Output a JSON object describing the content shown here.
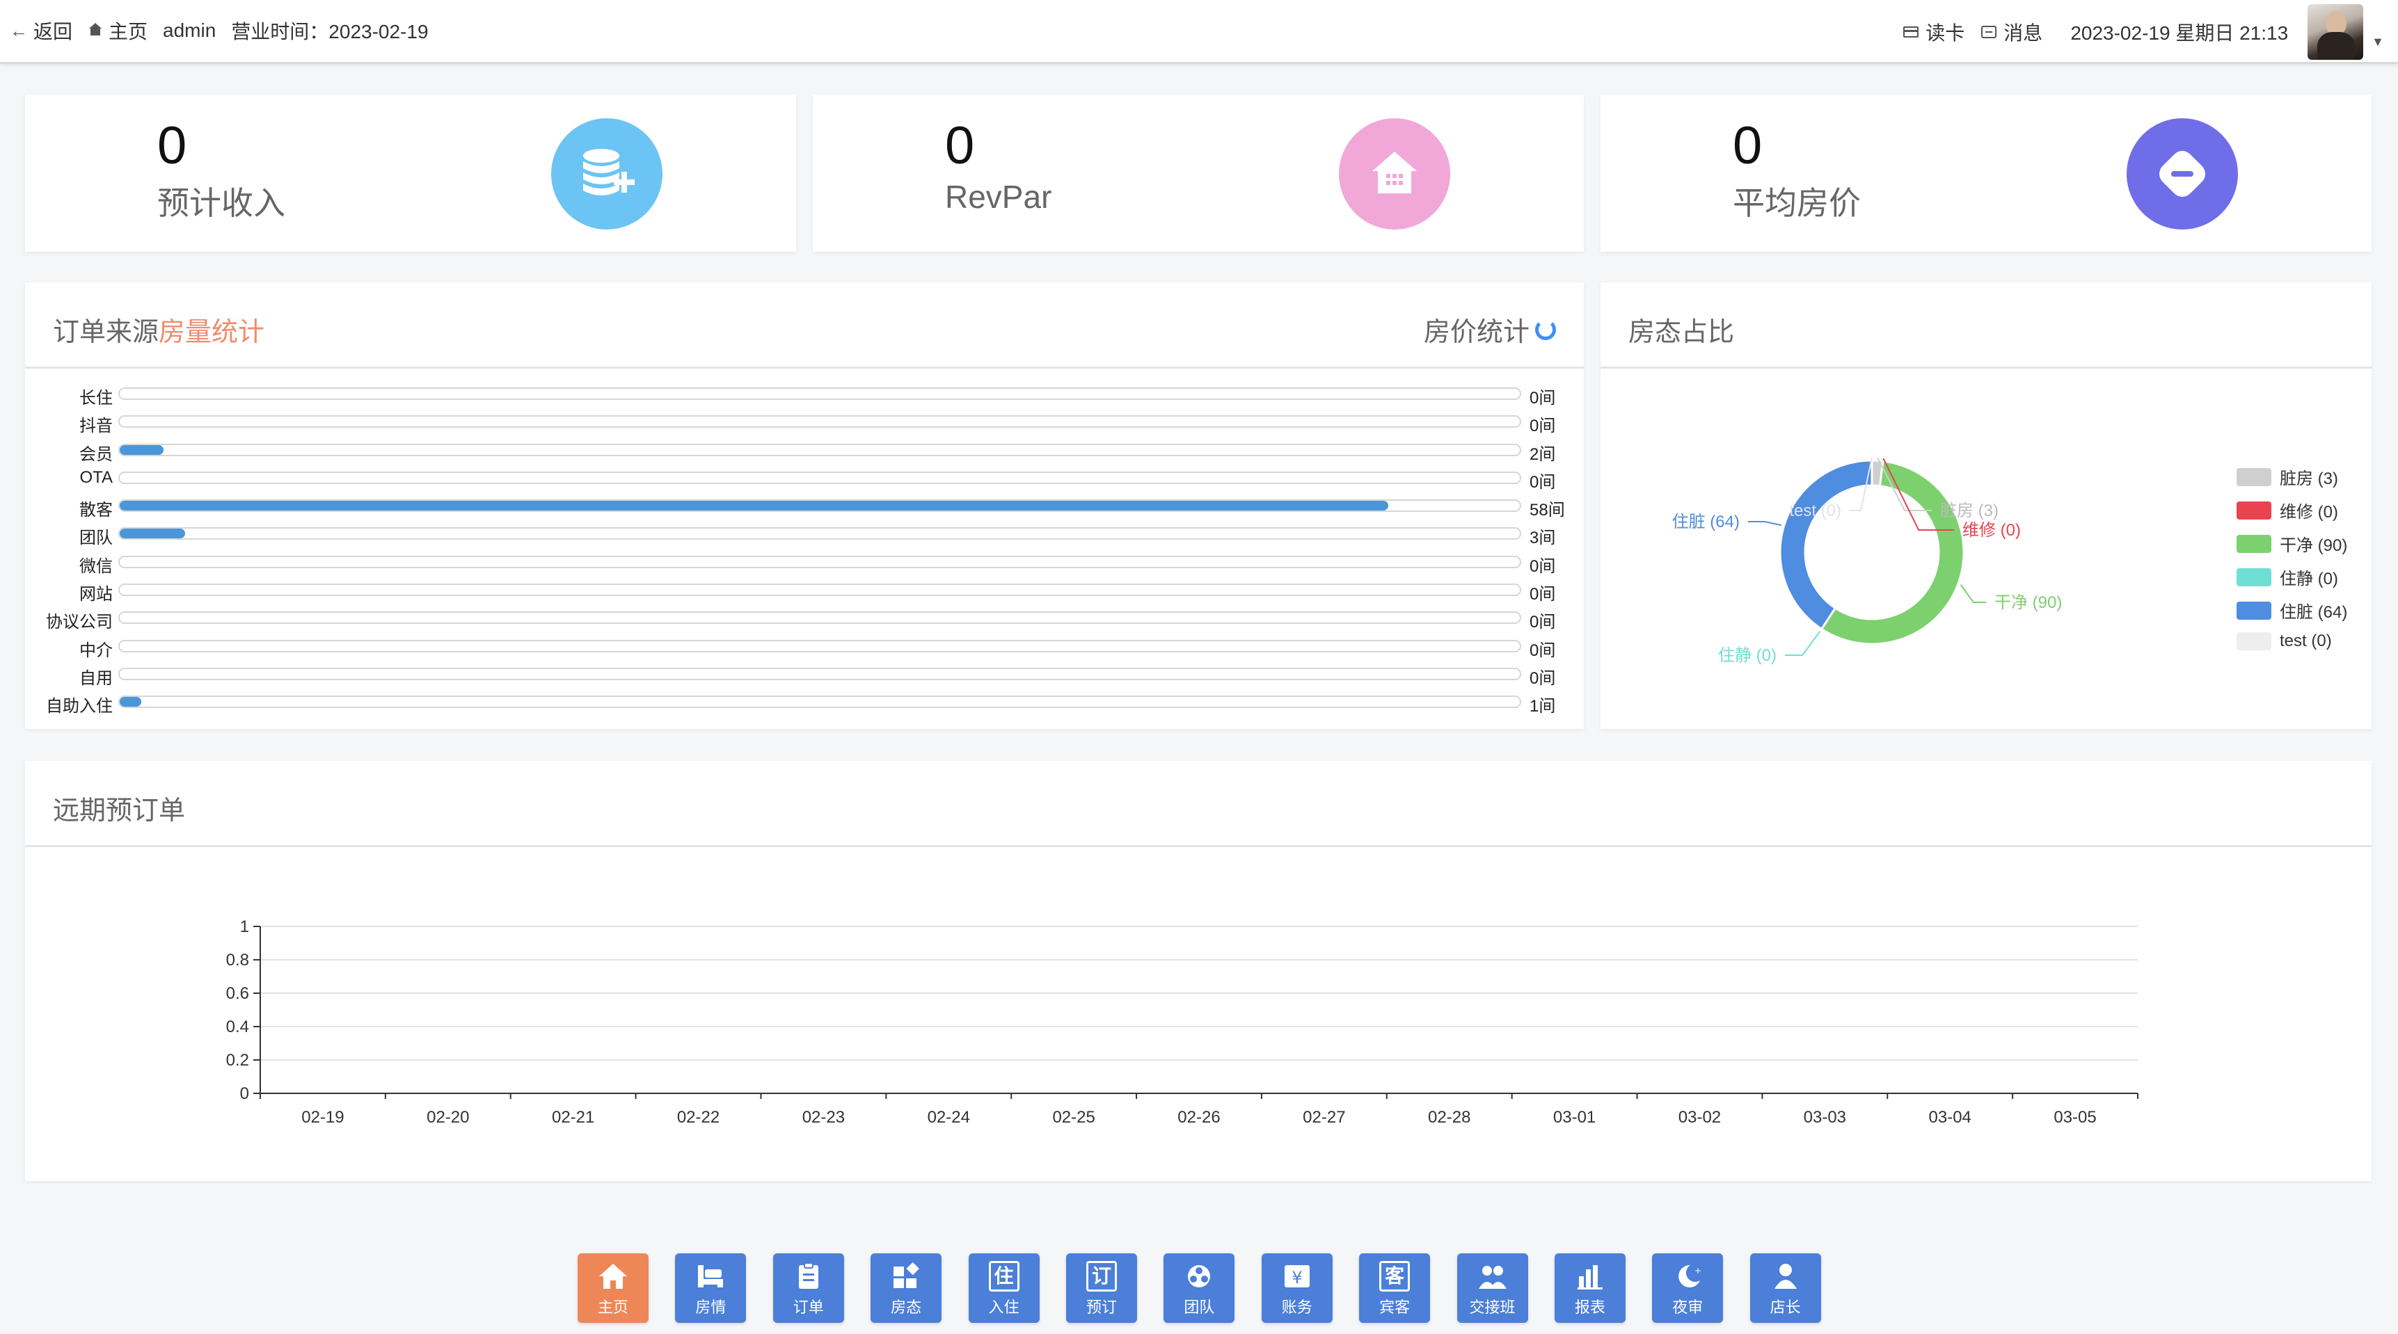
{
  "topbar": {
    "back": "返回",
    "home": "主页",
    "user": "admin",
    "business_time": "营业时间：2023-02-19",
    "read_card": "读卡",
    "message": "消息",
    "datetime": "2023-02-19 星期日 21:13"
  },
  "stats": [
    {
      "value": "0",
      "label": "预计收入",
      "icon": "coin-stack-plus-icon",
      "color": "#6cc4f4"
    },
    {
      "value": "0",
      "label": "RevPar",
      "icon": "house-icon",
      "color": "#f1a8d8"
    },
    {
      "value": "0",
      "label": "平均房价",
      "icon": "minus-circle-icon",
      "color": "#6f6ee8"
    }
  ],
  "order_panel": {
    "title_a": "订单来源",
    "title_b": "房量统计",
    "price_stat": "房价统计",
    "rows": [
      {
        "name": "长住",
        "value": 0,
        "label": "0间"
      },
      {
        "name": "抖音",
        "value": 0,
        "label": "0间"
      },
      {
        "name": "会员",
        "value": 2,
        "label": "2间"
      },
      {
        "name": "OTA",
        "value": 0,
        "label": "0间"
      },
      {
        "name": "散客",
        "value": 58,
        "label": "58间"
      },
      {
        "name": "团队",
        "value": 3,
        "label": "3间"
      },
      {
        "name": "微信",
        "value": 0,
        "label": "0间"
      },
      {
        "name": "网站",
        "value": 0,
        "label": "0间"
      },
      {
        "name": "协议公司",
        "value": 0,
        "label": "0间"
      },
      {
        "name": "中介",
        "value": 0,
        "label": "0间"
      },
      {
        "name": "自用",
        "value": 0,
        "label": "0间"
      },
      {
        "name": "自助入住",
        "value": 1,
        "label": "1间"
      }
    ],
    "max": 64
  },
  "room_panel": {
    "title": "房态占比",
    "slices": [
      {
        "name": "脏房",
        "value": 3,
        "label": "脏房 (3)",
        "color": "#cfcfcf"
      },
      {
        "name": "维修",
        "value": 0,
        "label": "维修 (0)",
        "color": "#e8434f"
      },
      {
        "name": "干净",
        "value": 90,
        "label": "干净 (90)",
        "color": "#7dd06e"
      },
      {
        "name": "住静",
        "value": 0,
        "label": "住静 (0)",
        "color": "#6fdfd3"
      },
      {
        "name": "住脏",
        "value": 64,
        "label": "住脏 (64)",
        "color": "#4e8de0"
      },
      {
        "name": "test",
        "value": 0,
        "label": "test (0)",
        "color": "#eeeeee"
      }
    ]
  },
  "future_panel": {
    "title": "远期预订单"
  },
  "chart_data": {
    "type": "line",
    "title": "",
    "categories": [
      "02-19",
      "02-20",
      "02-21",
      "02-22",
      "02-23",
      "02-24",
      "02-25",
      "02-26",
      "02-27",
      "02-28",
      "03-01",
      "03-02",
      "03-03",
      "03-04",
      "03-05"
    ],
    "series": [],
    "ylim": [
      0,
      1
    ],
    "yticks": [
      "0",
      "0.2",
      "0.4",
      "0.6",
      "0.8",
      "1"
    ],
    "grid": true
  },
  "dock": [
    {
      "label": "主页",
      "icon": "home-icon",
      "active": true
    },
    {
      "label": "房情",
      "icon": "bed-icon"
    },
    {
      "label": "订单",
      "icon": "clipboard-icon"
    },
    {
      "label": "房态",
      "icon": "grid-diamond-icon"
    },
    {
      "label": "入住",
      "icon": "checkin-icon",
      "glyph": "住"
    },
    {
      "label": "预订",
      "icon": "booking-icon",
      "glyph": "订"
    },
    {
      "label": "团队",
      "icon": "team-icon"
    },
    {
      "label": "账务",
      "icon": "ledger-icon"
    },
    {
      "label": "宾客",
      "icon": "guest-icon",
      "glyph": "客"
    },
    {
      "label": "交接班",
      "icon": "handover-icon"
    },
    {
      "label": "报表",
      "icon": "bar-chart-icon"
    },
    {
      "label": "夜审",
      "icon": "moon-icon"
    },
    {
      "label": "店长",
      "icon": "manager-icon"
    }
  ]
}
